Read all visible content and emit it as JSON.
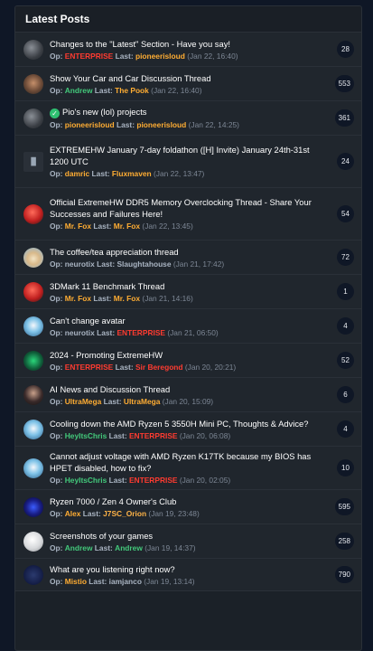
{
  "panel": {
    "title": "Latest Posts"
  },
  "labels": {
    "op": "Op:",
    "last": "Last:"
  },
  "threads": [
    {
      "title": "Changes to the \"Latest\" Section - Have you say!",
      "op": "ENTERPRISE",
      "op_color": "red",
      "last": "pioneerisloud",
      "last_color": "orange",
      "date": "(Jan 22, 16:40)",
      "count": "28",
      "avatar": "helmet-avatar",
      "check": false
    },
    {
      "title": "Show Your Car and Car Discussion Thread",
      "op": "Andrew",
      "op_color": "green",
      "last": "The Pook",
      "last_color": "orange",
      "date": "(Jan 22, 16:40)",
      "count": "553",
      "avatar": "man-avatar",
      "check": false
    },
    {
      "title": "Pio's new (lol) projects",
      "op": "pioneerisloud",
      "op_color": "orange",
      "last": "pioneerisloud",
      "last_color": "orange",
      "date": "(Jan 22, 14:25)",
      "count": "361",
      "avatar": "helmet-avatar",
      "check": true
    },
    {
      "title": "EXTREMEHW January 7-day foldathon ([H] Invite) January 24th-31st 1200 UTC",
      "op": "damric",
      "op_color": "orange",
      "last": "Fluxmaven",
      "last_color": "orange",
      "date": "(Jan 22, 13:47)",
      "count": "24",
      "avatar": "logo-avatar",
      "check": false
    },
    {
      "title": "Official ExtremeHW DDR5 Memory Overclocking Thread - Share Your Successes and Failures Here!",
      "op": "Mr. Fox",
      "op_color": "orange",
      "last": "Mr. Fox",
      "last_color": "orange",
      "date": "(Jan 22, 13:45)",
      "count": "54",
      "avatar": "fox-avatar",
      "check": false
    },
    {
      "title": "The coffee/tea appreciation thread",
      "op": "neurotix",
      "op_color": "default",
      "last": "Slaughtahouse",
      "last_color": "default",
      "date": "(Jan 21, 17:42)",
      "count": "72",
      "avatar": "cone-avatar",
      "check": false
    },
    {
      "title": "3DMark 11 Benchmark Thread",
      "op": "Mr. Fox",
      "op_color": "orange",
      "last": "Mr. Fox",
      "last_color": "orange",
      "date": "(Jan 21, 14:16)",
      "count": "1",
      "avatar": "fox-avatar",
      "check": false
    },
    {
      "title": "Can't change avatar",
      "op": "neurotix",
      "op_color": "default",
      "last": "ENTERPRISE",
      "last_color": "red",
      "date": "(Jan 21, 06:50)",
      "count": "4",
      "avatar": "anime-avatar",
      "check": false
    },
    {
      "title": "2024 - Promoting ExtremeHW",
      "op": "ENTERPRISE",
      "op_color": "red",
      "last": "Sir Beregond",
      "last_color": "red",
      "date": "(Jan 20, 20:21)",
      "count": "52",
      "avatar": "green-avatar",
      "check": false
    },
    {
      "title": "AI News and Discussion Thread",
      "op": "UltraMega",
      "op_color": "orange",
      "last": "UltraMega",
      "last_color": "orange",
      "date": "(Jan 20, 15:09)",
      "count": "6",
      "avatar": "hood-avatar",
      "check": false
    },
    {
      "title": "Cooling down the AMD Ryzen 5 3550H Mini PC, Thoughts & Advice?",
      "op": "HeyItsChris",
      "op_color": "green",
      "last": "ENTERPRISE",
      "last_color": "red",
      "date": "(Jan 20, 06:08)",
      "count": "4",
      "avatar": "anime-avatar",
      "check": false
    },
    {
      "title": "Cannot adjust voltage with AMD Ryzen K17TK because my BIOS has HPET disabled, how to fix?",
      "op": "HeyItsChris",
      "op_color": "green",
      "last": "ENTERPRISE",
      "last_color": "red",
      "date": "(Jan 20, 02:05)",
      "count": "10",
      "avatar": "anime-avatar",
      "check": false
    },
    {
      "title": "Ryzen 7000 / Zen 4 Owner's Club",
      "op": "Alex",
      "op_color": "orange",
      "last": "J7SC_Orion",
      "last_color": "yellow",
      "date": "(Jan 19, 23:48)",
      "count": "595",
      "avatar": "space-avatar",
      "check": false
    },
    {
      "title": "Screenshots of your games",
      "op": "Andrew",
      "op_color": "green",
      "last": "Andrew",
      "last_color": "green",
      "date": "(Jan 19, 14:37)",
      "count": "258",
      "avatar": "white-avatar",
      "check": false
    },
    {
      "title": "What are you listening right now?",
      "op": "Mistio",
      "op_color": "orange",
      "last": "iamjanco",
      "last_color": "default",
      "date": "(Jan 19, 13:14)",
      "count": "790",
      "avatar": "dark-avatar",
      "check": false
    }
  ]
}
